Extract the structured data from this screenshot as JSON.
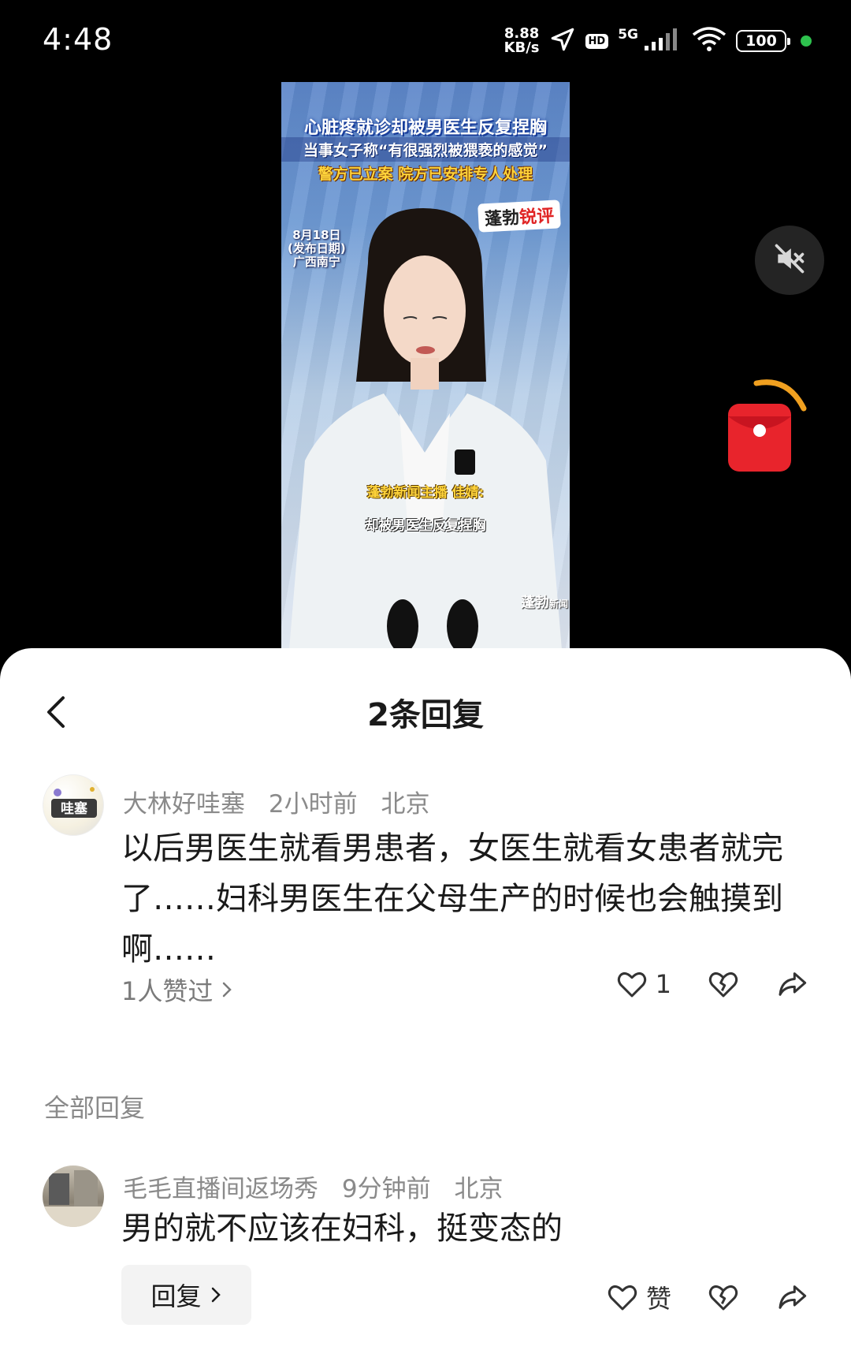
{
  "status_bar": {
    "time": "4:48",
    "net_speed_value": "8.88",
    "net_speed_unit": "KB/s",
    "hd_label": "HD",
    "signal_label": "5G",
    "battery": "100",
    "colors": {
      "dot": "#2ec24e"
    }
  },
  "video": {
    "headline_1": "心脏疼就诊却被男医生反复捏胸",
    "headline_2": "当事女子称“有很强烈被猥亵的感觉”",
    "headline_3": "警方已立案 院方已安排专人处理",
    "brand_a": "蓬勃",
    "brand_b": "锐评",
    "date_line_1": "8月18日",
    "date_line_2": "(发布日期)",
    "date_line_3": "广西南宁",
    "subtitle_1": "蓬勃新闻主播 佳婧:",
    "subtitle_2": "却被男医生反复捏胸",
    "watermark_main": "蓬勃",
    "watermark_sub": "新闻"
  },
  "icons": {
    "mute": "speaker-muted-icon",
    "red_packet": "red-envelope-icon",
    "back": "chevron-left-icon",
    "like": "heart-outline-icon",
    "dislike": "broken-heart-icon",
    "share": "share-arrow-icon"
  },
  "sheet": {
    "title": "2条回复",
    "main_comment": {
      "username": "大林好哇塞",
      "time": "2小时前",
      "location": "北京",
      "avatar_text": "哇塞",
      "text": "以后男医生就看男患者，女医生就看女患者就完了……妇科男医生在父母生产的时候也会触摸到啊……",
      "likes_info": "1人赞过",
      "like_count": "1"
    },
    "section_label": "全部回复",
    "reply": {
      "username": "毛毛直播间返场秀",
      "time": "9分钟前",
      "location": "北京",
      "text": "男的就不应该在妇科，挺变态的",
      "reply_label": "回复",
      "like_label": "赞"
    }
  }
}
